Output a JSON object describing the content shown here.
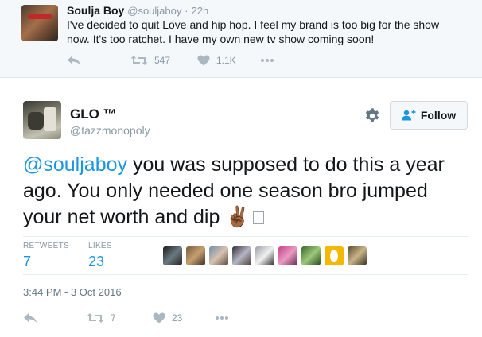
{
  "quoted": {
    "name": "Soulja Boy",
    "handle": "@souljaboy",
    "sep": "·",
    "time": "22h",
    "text": "I've decided to quit Love and hip hop. I feel my brand is too big for the show now. It's too ratchet. I have my own new tv show coming soon!",
    "retweets": "547",
    "likes": "1.1K"
  },
  "tweet": {
    "name": "GLO ™",
    "handle": "@tazzmonopoly",
    "follow_label": "Follow",
    "mention": "@souljaboy",
    "text": " you was supposed to do this a year ago. You only needed one season bro jumped your net worth and dip ",
    "emoji": "✌🏾",
    "retweets_label": "RETWEETS",
    "retweets_count": "7",
    "likes_label": "LIKES",
    "likes_count": "23",
    "timestamp": "3:44 PM - 3 Oct 2016",
    "action_retweets": "7",
    "action_likes": "23"
  },
  "colors": {
    "link": "#1b95e0",
    "muted": "#8899a6",
    "text": "#14171a",
    "quoted_bg": "#f5f8fa"
  },
  "icons": [
    "reply-icon",
    "retweet-icon",
    "heart-icon",
    "more-icon",
    "gear-icon",
    "follow-person-icon"
  ]
}
